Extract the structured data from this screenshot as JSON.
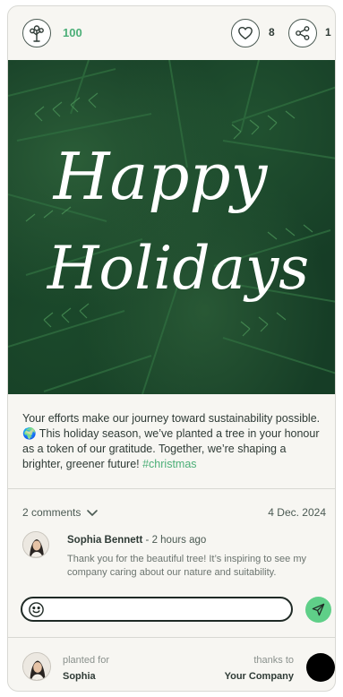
{
  "header": {
    "tree_count": "100",
    "like_count": "8",
    "share_count": "1"
  },
  "hero": {
    "greeting_line1": "Happy",
    "greeting_line2": "Holidays"
  },
  "post": {
    "message": "Your efforts make our journey toward sustainability possible. 🌍 This holiday season, we’ve planted a tree in your honour as a token of our gratitude. Together, we’re shaping a brighter, greener future! ",
    "hashtag": "#christmas"
  },
  "comments": {
    "count_label": "2 comments",
    "date": "4 Dec. 2024",
    "items": [
      {
        "author": "Sophia Bennett",
        "time": " - 2 hours ago",
        "text": "Thank you for the beautiful tree! It’s inspiring to see my company caring about our nature and suitability."
      }
    ],
    "input_value": "",
    "input_placeholder": ""
  },
  "footer": {
    "planted_for_label": "planted for",
    "planted_for_name": "Sophia",
    "thanks_to_label": "thanks to",
    "thanks_to_name": "Your Company"
  },
  "colors": {
    "accent_green": "#4caf78",
    "send_button": "#5fcf88",
    "card_background": "#f7f6f2"
  },
  "icons": [
    "tree-icon",
    "heart-icon",
    "share-icon",
    "chevron-down-icon",
    "emoji-icon",
    "send-icon"
  ]
}
